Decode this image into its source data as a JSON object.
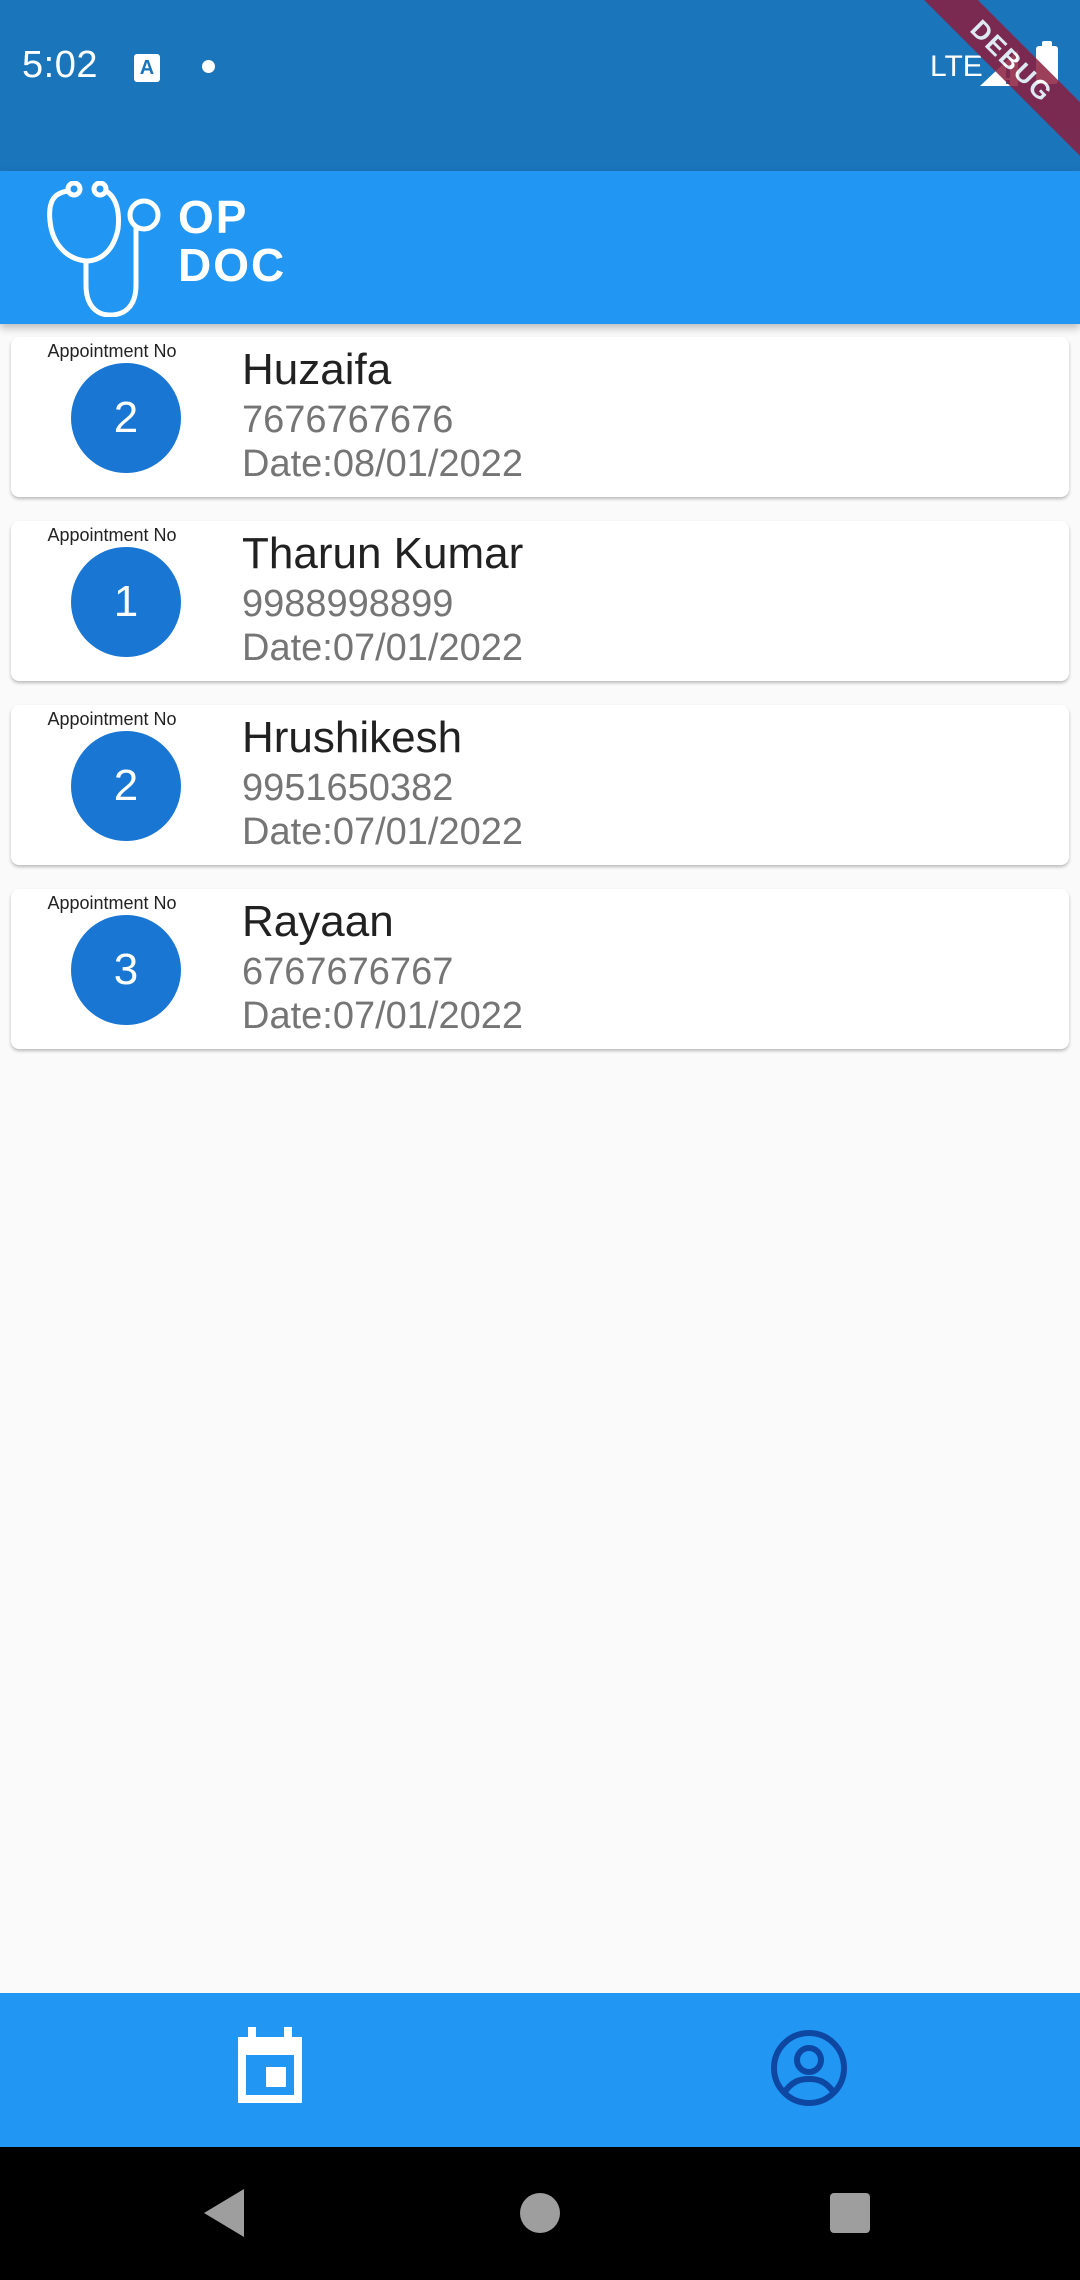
{
  "status_bar": {
    "time": "5:02",
    "network": "LTE",
    "debug_label": "DEBUG"
  },
  "app_bar": {
    "logo_line1": "OP",
    "logo_line2": "DOC"
  },
  "appointments": [
    {
      "label": "Appointment No",
      "number": "2",
      "name": "Huzaifa",
      "phone": "7676767676",
      "date": "Date:08/01/2022"
    },
    {
      "label": "Appointment No",
      "number": "1",
      "name": "Tharun Kumar",
      "phone": "9988998899",
      "date": "Date:07/01/2022"
    },
    {
      "label": "Appointment No",
      "number": "2",
      "name": "Hrushikesh",
      "phone": "9951650382",
      "date": "Date:07/01/2022"
    },
    {
      "label": "Appointment No",
      "number": "3",
      "name": "Rayaan",
      "phone": "6767676767",
      "date": "Date:07/01/2022"
    }
  ],
  "bottom_nav": {
    "items": [
      {
        "icon": "calendar-icon",
        "active": true
      },
      {
        "icon": "account-circle-icon",
        "active": false
      }
    ]
  },
  "colors": {
    "status_bar": "#1b75bb",
    "app_bar": "#2196f3",
    "circle": "#1976d2",
    "inactive_nav": "#0d47a1"
  }
}
